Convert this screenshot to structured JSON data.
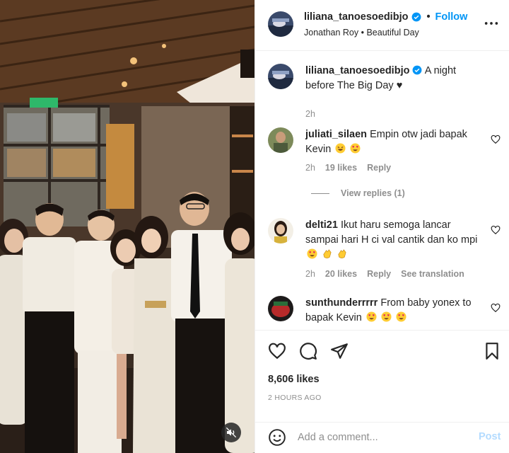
{
  "header": {
    "username": "liliana_tanoesoedibjo",
    "separator": "•",
    "follow_label": "Follow",
    "audio": "Jonathan Roy • Beautiful Day"
  },
  "caption": {
    "username": "liliana_tanoesoedibjo",
    "text": "A night before The Big Day ♥",
    "time": "2h"
  },
  "comments": [
    {
      "username": "juliati_silaen",
      "text": "Empin otw jadi bapak Kevin",
      "emojis": [
        "laughing",
        "heart-eyes"
      ],
      "time": "2h",
      "likes": "19 likes",
      "reply": "Reply",
      "view_replies": "View replies (1)"
    },
    {
      "username": "delti21",
      "text": "Ikut haru semoga lancar sampai hari H ci val cantik dan ko mpi",
      "emojis": [
        "heart-eyes",
        "clap",
        "clap"
      ],
      "time": "2h",
      "likes": "20 likes",
      "reply": "Reply",
      "translation": "See translation"
    },
    {
      "username": "sunthunderrrrr",
      "text": "From baby yonex to bapak Kevin",
      "emojis": [
        "heart-eyes",
        "heart-eyes",
        "heart-eyes"
      ]
    }
  ],
  "stats": {
    "likes": "8,606 likes",
    "posted": "2 HOURS AGO"
  },
  "add_comment": {
    "placeholder": "Add a comment...",
    "post_label": "Post"
  },
  "icons": {
    "verified": "verified-badge-icon",
    "more": "more-options-icon",
    "like": "heart-icon",
    "comment": "comment-icon",
    "share": "share-icon",
    "save": "bookmark-icon",
    "emoji": "emoji-icon",
    "mute": "muted-speaker-icon"
  },
  "colors": {
    "link_blue": "#0095f6",
    "verified_blue": "#0095f6",
    "post_disabled": "#b3dbff",
    "meta_gray": "#8e8e8e",
    "emoji_yellow": "#ffcc33"
  }
}
